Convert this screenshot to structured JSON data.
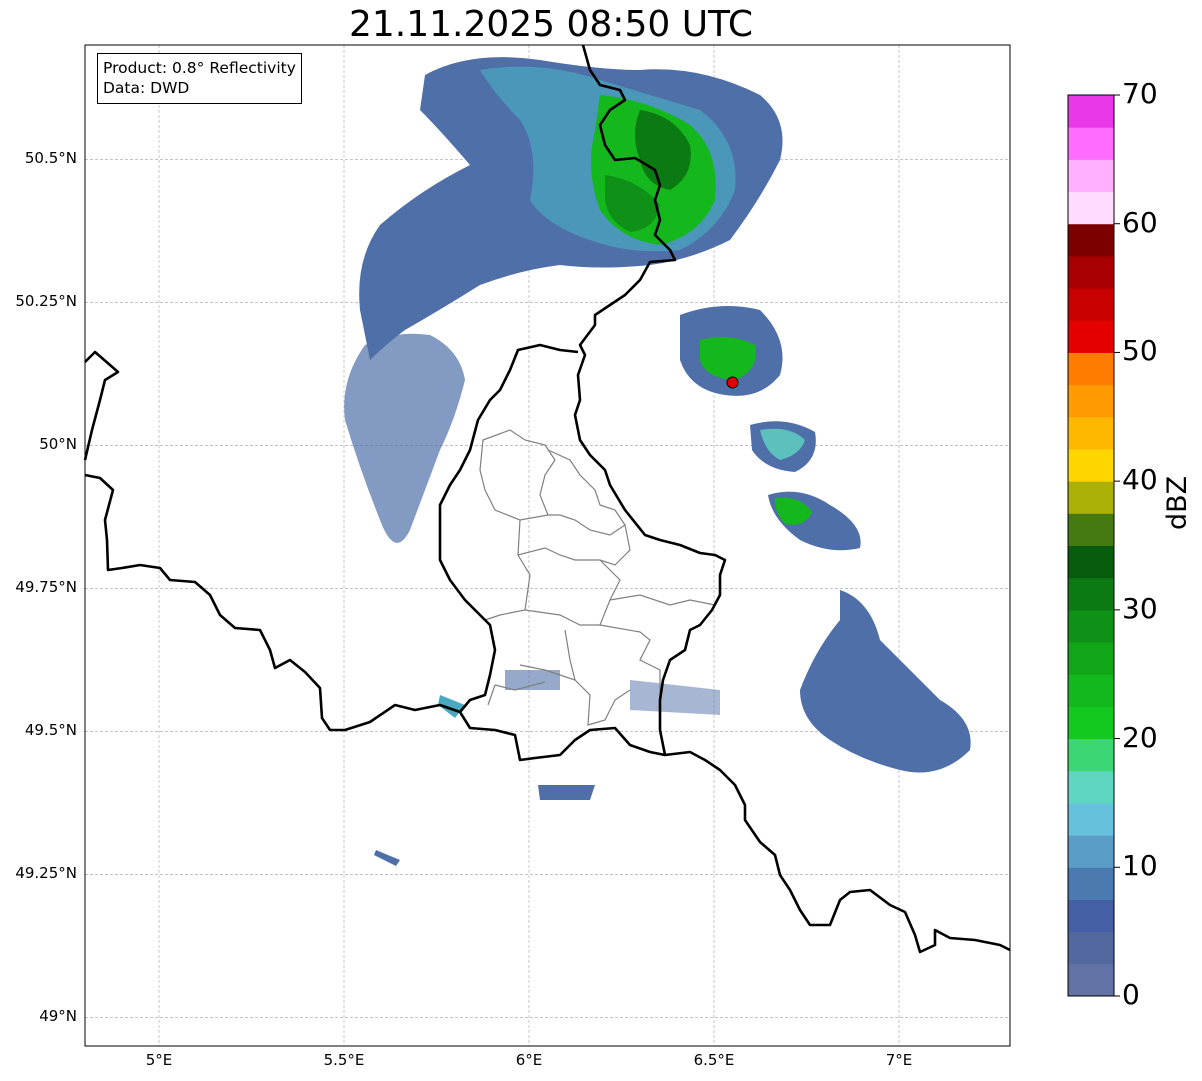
{
  "title": "21.11.2025 08:50 UTC",
  "info": {
    "product": "Product: 0.8° Reflectivity",
    "source": "Data: DWD"
  },
  "map": {
    "lon_range": [
      4.8,
      7.3
    ],
    "lat_range": [
      48.95,
      50.7
    ],
    "lat_ticks": [
      {
        "value": 50.5,
        "label": "50.5°N"
      },
      {
        "value": 50.25,
        "label": "50.25°N"
      },
      {
        "value": 50.0,
        "label": "50°N"
      },
      {
        "value": 49.75,
        "label": "49.75°N"
      },
      {
        "value": 49.5,
        "label": "49.5°N"
      },
      {
        "value": 49.25,
        "label": "49.25°N"
      },
      {
        "value": 49.0,
        "label": "49°N"
      }
    ],
    "lon_ticks": [
      {
        "value": 5.0,
        "label": "5°E"
      },
      {
        "value": 5.5,
        "label": "5.5°E"
      },
      {
        "value": 6.0,
        "label": "6°E"
      },
      {
        "value": 6.5,
        "label": "6.5°E"
      },
      {
        "value": 7.0,
        "label": "7°E"
      }
    ],
    "grid": true,
    "marker": {
      "lon": 6.55,
      "lat": 50.11,
      "color": "#e00000"
    }
  },
  "colorbar": {
    "label": "dBZ",
    "min": 0,
    "max": 70,
    "ticks": [
      "0",
      "10",
      "20",
      "30",
      "40",
      "50",
      "60",
      "70"
    ],
    "colors": [
      "#6272a4",
      "#53689e",
      "#455fa5",
      "#4a7ab0",
      "#5a9ec8",
      "#66c2dc",
      "#5fd6c0",
      "#3dd674",
      "#13c81e",
      "#12b81c",
      "#11a618",
      "#0f9016",
      "#0b7a12",
      "#085c0e",
      "#457a12",
      "#aab006",
      "#ffd600",
      "#ffb800",
      "#ff9a00",
      "#ff7c00",
      "#e50000",
      "#c80000",
      "#a80000",
      "#7c0000",
      "#ffdcff",
      "#ffb0ff",
      "#ff6cff",
      "#e838e8"
    ]
  }
}
